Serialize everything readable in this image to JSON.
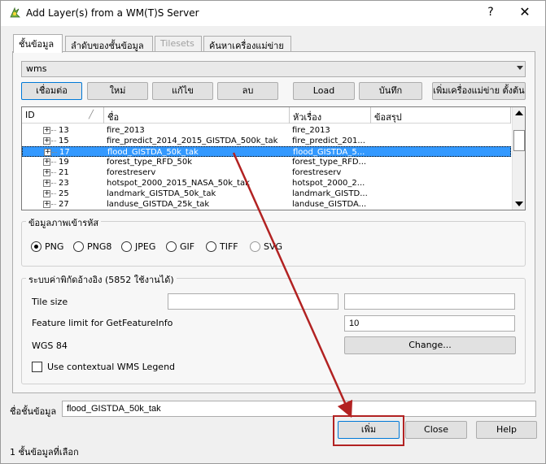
{
  "window": {
    "title": "Add Layer(s) from a WM(T)S Server",
    "help_glyph": "?",
    "close_glyph": "✕"
  },
  "tabs": [
    {
      "label": "ชั้นข้อมูล"
    },
    {
      "label": "ลำดับของชั้นข้อมูล"
    },
    {
      "label": "Tilesets"
    },
    {
      "label": "ค้นหาเครื่องแม่ข่าย"
    }
  ],
  "connection": {
    "selected": "wms"
  },
  "toolbar": {
    "connect": "เชื่อมต่อ",
    "new": "ใหม่",
    "edit": "แก้ไข",
    "delete": "ลบ",
    "load": "Load",
    "save": "บันทึก",
    "add_default": "เพิ่มเครื่องแม่ข่าย ตั้งต้น"
  },
  "layer_table": {
    "columns": [
      "ID",
      "ชื่อ",
      "หัวเรื่อง",
      "ข้อสรุป"
    ],
    "expander_glyph": "+",
    "rows": [
      {
        "id": "13",
        "name": "fire_2013",
        "title": "fire_2013",
        "selected": false
      },
      {
        "id": "15",
        "name": "fire_predict_2014_2015_GISTDA_500k_tak",
        "title": "fire_predict_201...",
        "selected": false
      },
      {
        "id": "17",
        "name": "flood_GISTDA_50k_tak",
        "title": "flood_GISTDA_5...",
        "selected": true
      },
      {
        "id": "19",
        "name": "forest_type_RFD_50k",
        "title": "forest_type_RFD...",
        "selected": false
      },
      {
        "id": "21",
        "name": "forestreserv",
        "title": "forestreserv",
        "selected": false
      },
      {
        "id": "23",
        "name": "hotspot_2000_2015_NASA_50k_tak",
        "title": "hotspot_2000_2...",
        "selected": false
      },
      {
        "id": "25",
        "name": "landmark_GISTDA_50k_tak",
        "title": "landmark_GISTD...",
        "selected": false
      },
      {
        "id": "27",
        "name": "landuse_GISTDA_25k_tak",
        "title": "landuse_GISTDA...",
        "selected": false
      }
    ]
  },
  "image_encoding": {
    "title": "ข้อมูลภาพเข้ารหัส",
    "options": [
      {
        "label": "PNG",
        "checked": true,
        "enabled": true
      },
      {
        "label": "PNG8",
        "checked": false,
        "enabled": true
      },
      {
        "label": "JPEG",
        "checked": false,
        "enabled": true
      },
      {
        "label": "GIF",
        "checked": false,
        "enabled": true
      },
      {
        "label": "TIFF",
        "checked": false,
        "enabled": true
      },
      {
        "label": "SVG",
        "checked": false,
        "enabled": false
      }
    ]
  },
  "options": {
    "title": "ระบบค่าพิกัดอ้างอิง (5852 ใช้งานได้)",
    "tile_size_label": "Tile size",
    "tile_width": "",
    "tile_height": "",
    "feature_limit_label": "Feature limit for GetFeatureInfo",
    "feature_limit": "10",
    "crs_label": "WGS 84",
    "change_button": "Change...",
    "legend_label": "Use contextual WMS Legend"
  },
  "layer_name": {
    "label": "ชื่อชั้นข้อมูล",
    "value": "flood_GISTDA_50k_tak"
  },
  "footer": {
    "add": "เพิ่ม",
    "close": "Close",
    "help": "Help",
    "status": "1 ชั้นข้อมูลที่เลือก"
  },
  "colors": {
    "selection": "#3399ff",
    "annotation": "#b22222"
  }
}
